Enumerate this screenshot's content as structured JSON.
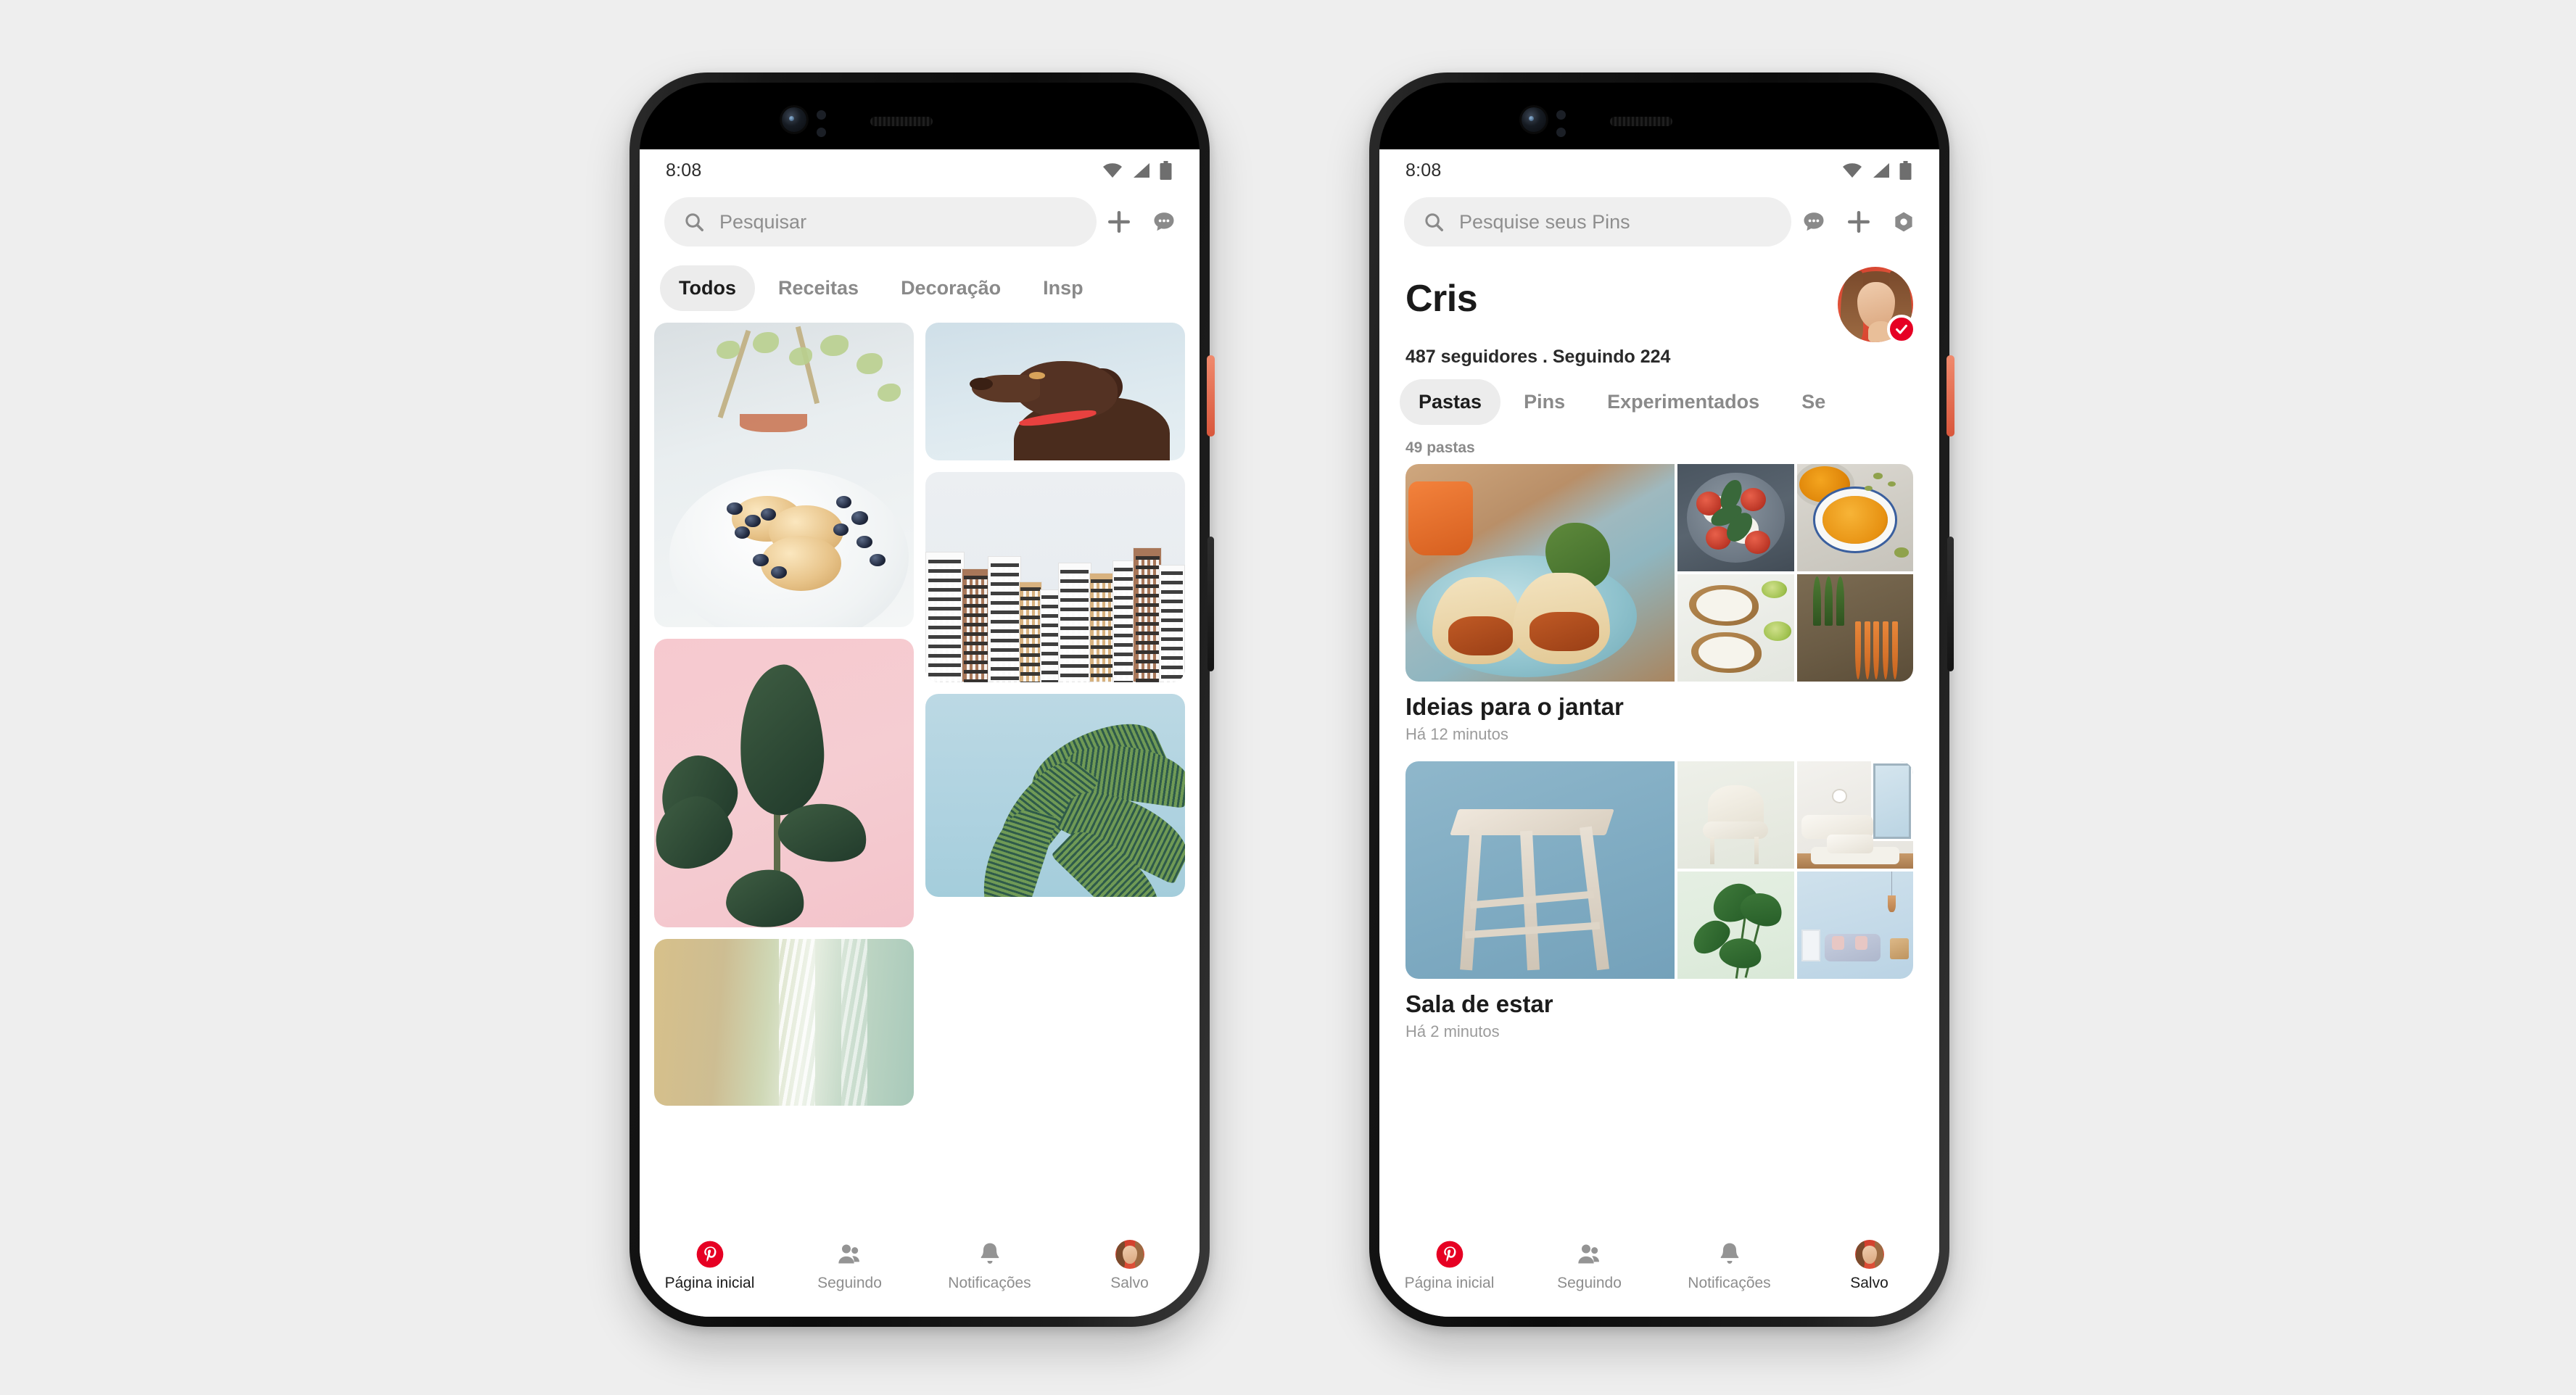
{
  "app": {
    "name": "Pinterest",
    "brand_color": "#e60023"
  },
  "phones": {
    "left": {
      "status": {
        "time": "8:08",
        "wifi_icon": "wifi-icon",
        "signal_icon": "signal-icon",
        "battery_icon": "battery-icon"
      },
      "search": {
        "placeholder": "Pesquisar",
        "icon": "search-icon"
      },
      "header_actions": [
        {
          "name": "create-pin-button",
          "icon": "plus-icon"
        },
        {
          "name": "messages-button",
          "icon": "chat-bubble-icon"
        }
      ],
      "tabs": [
        {
          "label": "Todos",
          "active": true
        },
        {
          "label": "Receitas",
          "active": false
        },
        {
          "label": "Decoração",
          "active": false
        },
        {
          "label": "Insp",
          "active": false
        }
      ],
      "pins": [
        {
          "name": "pin-pancakes-blueberries",
          "alt": "Panquecas com mirtilos em prato branco"
        },
        {
          "name": "pin-plant-pink",
          "alt": "Planta de borracha em fundo rosa"
        },
        {
          "name": "pin-beach-aerial",
          "alt": "Vista aérea de praia"
        },
        {
          "name": "pin-chocolate-labrador",
          "alt": "Labrador chocolate em fundo azul"
        },
        {
          "name": "pin-apartment-buildings",
          "alt": "Prédios de apartamentos"
        },
        {
          "name": "pin-palm-tree",
          "alt": "Palmeira contra o céu azul"
        }
      ],
      "nav": [
        {
          "label": "Página inicial",
          "icon": "pinterest-logo-icon",
          "active": true
        },
        {
          "label": "Seguindo",
          "icon": "people-icon",
          "active": false
        },
        {
          "label": "Notificações",
          "icon": "bell-icon",
          "active": false
        },
        {
          "label": "Salvo",
          "icon": "avatar-icon",
          "active": false
        }
      ]
    },
    "right": {
      "status": {
        "time": "8:08",
        "wifi_icon": "wifi-icon",
        "signal_icon": "signal-icon",
        "battery_icon": "battery-icon"
      },
      "search": {
        "placeholder": "Pesquise seus Pins",
        "icon": "search-icon"
      },
      "header_actions": [
        {
          "name": "messages-button",
          "icon": "chat-bubble-icon"
        },
        {
          "name": "create-pin-button",
          "icon": "plus-icon"
        },
        {
          "name": "settings-button",
          "icon": "gear-icon"
        }
      ],
      "profile": {
        "name": "Cris",
        "stats": "487 seguidores . Seguindo 224",
        "verified": true,
        "avatar_alt": "Foto de perfil de Cris"
      },
      "tabs": [
        {
          "label": "Pastas",
          "active": true
        },
        {
          "label": "Pins",
          "active": false
        },
        {
          "label": "Experimentados",
          "active": false
        },
        {
          "label": "Se",
          "active": false
        }
      ],
      "boards_count": "49 pastas",
      "boards": [
        {
          "title": "Ideias para o jantar",
          "updated": "Há 12 minutos",
          "tiles": [
            "Tacos em prato azul",
            "Salada caprese",
            "Torradas com ricota",
            "Sopa de abóbora",
            "Legumes frescos"
          ]
        },
        {
          "title": "Sala de estar",
          "updated": "Há 2 minutos",
          "tiles": [
            "Banco de madeira",
            "Poltrona branca",
            "Monstera",
            "Sala de estar moderna",
            "Sala azul"
          ]
        }
      ],
      "nav": [
        {
          "label": "Página inicial",
          "icon": "pinterest-logo-icon",
          "active": false
        },
        {
          "label": "Seguindo",
          "icon": "people-icon",
          "active": false
        },
        {
          "label": "Notificações",
          "icon": "bell-icon",
          "active": false
        },
        {
          "label": "Salvo",
          "icon": "avatar-icon",
          "active": true
        }
      ]
    }
  }
}
